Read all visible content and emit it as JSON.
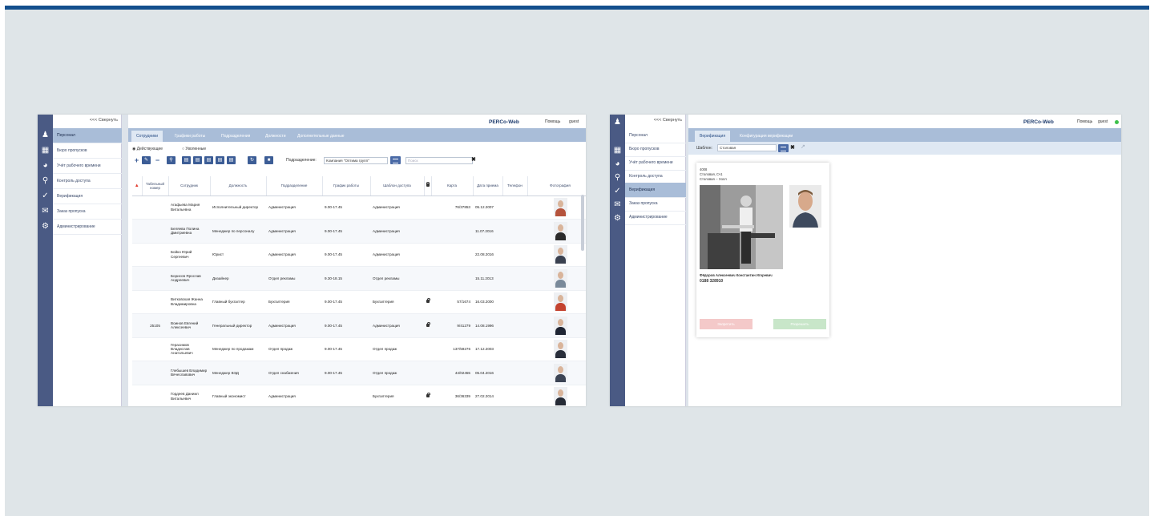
{
  "left": {
    "collapse": "<<< Свернуть",
    "app_title": "PERCo-Web",
    "help": "Помощь",
    "user": "guest",
    "nav": [
      "Персонал",
      "Бюро пропусков",
      "Учёт рабочего времени",
      "Контроль доступа",
      "Верификация",
      "Заказ пропуска",
      "Администрирование"
    ],
    "tabs": [
      "Сотрудники",
      "Графики работы",
      "Подразделения",
      "Должности",
      "Дополнительные данные"
    ],
    "radio_active": "Действующие",
    "radio_fired": "Уволенные",
    "filter_label": "Подразделение:",
    "filter_value": "Компания \"Оптима групп\"",
    "search_placeholder": "Поиск",
    "columns": [
      "Табельный номер",
      "Сотрудник",
      "Должность",
      "Подразделение",
      "График работы",
      "Шаблон доступа",
      "Карта",
      "Дата приема",
      "Телефон",
      "Фотография"
    ],
    "rows": [
      {
        "tab": "",
        "name": "Агафьева Мария Витальевна",
        "pos": "Исполнительный директор",
        "dept": "Администрация",
        "sched": "9.00-17.45",
        "tpl": "Администрация",
        "lock": false,
        "card": "76/37853",
        "date": "05.12.2007",
        "body": "#b5533c"
      },
      {
        "tab": "",
        "name": "Беляева Полина Дмитриевна",
        "pos": "Менеджер по персоналу",
        "dept": "Администрация",
        "sched": "9.00-17.45",
        "tpl": "Администрация",
        "lock": false,
        "card": "",
        "date": "11.07.2016",
        "body": "#2b2b2b"
      },
      {
        "tab": "",
        "name": "Бойко Юрий Сергеевич",
        "pos": "Юрист",
        "dept": "Администрация",
        "sched": "9.00-17.45",
        "tpl": "Администрация",
        "lock": false,
        "card": "",
        "date": "22.08.2016",
        "body": "#3a4150"
      },
      {
        "tab": "",
        "name": "Борисов Ярослав Андреевич",
        "pos": "Дизайнер",
        "dept": "Отдел рекламы",
        "sched": "9.30-18.15",
        "tpl": "Отдел рекламы",
        "lock": false,
        "card": "",
        "date": "15.11.2013",
        "body": "#7a8a9a"
      },
      {
        "tab": "",
        "name": "Витковская Жанна Владимировна",
        "pos": "Главный бухгалтер",
        "dept": "Бухгалтерия",
        "sched": "9.00-17.45",
        "tpl": "Бухгалтерия",
        "lock": true,
        "card": "57/1674",
        "date": "16.03.2000",
        "body": "#c4432f"
      },
      {
        "tab": "25105",
        "name": "Воинов Евгений Алексеевич",
        "pos": "Генеральный директор",
        "dept": "Администрация",
        "sched": "9.00-17.45",
        "tpl": "Администрация",
        "lock": true,
        "card": "9/41279",
        "date": "14.08.1996",
        "body": "#1f2533"
      },
      {
        "tab": "",
        "name": "Герасимов Владислав Анатольевич",
        "pos": "Менеджер по продажам",
        "dept": "Отдел продаж",
        "sched": "9.00-17.45",
        "tpl": "Отдел продаж",
        "lock": false,
        "card": "137/59276",
        "date": "17.12.2003",
        "body": "#2a2f3b"
      },
      {
        "tab": "",
        "name": "Глебышев Владимир Вячеславович",
        "pos": "Менеджер ВЭД",
        "dept": "Отдел снабжения",
        "sched": "9.00-17.45",
        "tpl": "Отдел продаж",
        "lock": false,
        "card": "44/02455",
        "date": "05.04.2016",
        "body": "#3c4454"
      },
      {
        "tab": "",
        "name": "Гордеев Даниил Витальевич",
        "pos": "Главный экономист",
        "dept": "Администрация",
        "sched": "",
        "tpl": "Бухгалтерия",
        "lock": true,
        "card": "36/36339",
        "date": "27.02.2014",
        "body": "#262b36"
      }
    ]
  },
  "right": {
    "collapse": "<<< Свернуть",
    "app_title": "PERCo-Web",
    "help": "Помощь",
    "user": "guest",
    "nav": [
      "Персонал",
      "Бюро пропусков",
      "Учёт рабочего времени",
      "Контроль доступа",
      "Верификация",
      "Заказ пропуска",
      "Администрирование"
    ],
    "tabs": [
      "Верификация",
      "Конфигурация верификации"
    ],
    "template_label": "Шаблон:",
    "template_value": "Столовая",
    "card": {
      "line1": "4008",
      "line2": "Столовая, Сч1",
      "line3": "Столовая -- Холл",
      "person": "Фёдоров Алексеевич Константин Игоревич",
      "code": "0188 328910",
      "deny": "Запретить",
      "allow": "Разрешить"
    }
  },
  "colors": {
    "iconbar": "#4a5a84",
    "tabbar": "#a9bdd8",
    "active_nav": "#a9bdd8",
    "accent": "#134f8d"
  }
}
